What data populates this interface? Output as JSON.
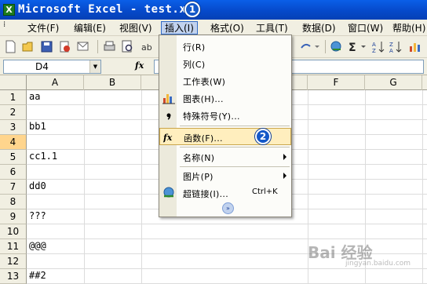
{
  "window": {
    "title": "Microsoft Excel - test.xls",
    "callout_1": "1",
    "title_color": "#0a5fe8"
  },
  "menubar": {
    "items": [
      {
        "label": "文件(F)"
      },
      {
        "label": "编辑(E)"
      },
      {
        "label": "视图(V)"
      },
      {
        "label": "插入(I)",
        "active": true
      },
      {
        "label": "格式(O)"
      },
      {
        "label": "工具(T)"
      },
      {
        "label": "数据(D)"
      },
      {
        "label": "窗口(W)"
      },
      {
        "label": "帮助(H)"
      }
    ]
  },
  "formula_bar": {
    "name_box": "D4",
    "fx": "fx"
  },
  "grid": {
    "columns": [
      "A",
      "B",
      "F",
      "G"
    ],
    "rows": [
      {
        "num": "1",
        "a": "aa"
      },
      {
        "num": "2",
        "a": ""
      },
      {
        "num": "3",
        "a": "bb1"
      },
      {
        "num": "4",
        "a": "",
        "selected": true
      },
      {
        "num": "5",
        "a": "cc1.1"
      },
      {
        "num": "6",
        "a": ""
      },
      {
        "num": "7",
        "a": "dd0"
      },
      {
        "num": "8",
        "a": ""
      },
      {
        "num": "9",
        "a": "???"
      },
      {
        "num": "10",
        "a": ""
      },
      {
        "num": "11",
        "a": "@@@"
      },
      {
        "num": "12",
        "a": ""
      },
      {
        "num": "13",
        "a": "##2"
      }
    ]
  },
  "insert_menu": {
    "items": [
      {
        "label": "行(R)",
        "icon": "none"
      },
      {
        "label": "列(C)",
        "icon": "none"
      },
      {
        "label": "工作表(W)",
        "icon": "none"
      },
      {
        "label": "图表(H)...",
        "icon": "chart-icon"
      },
      {
        "label": "特殊符号(Y)...",
        "icon": "comma-icon"
      },
      {
        "label": "函数(F)...",
        "icon": "fx-icon",
        "highlighted": true
      },
      {
        "label": "名称(N)",
        "icon": "none",
        "submenu": true
      },
      {
        "label": "图片(P)",
        "icon": "none",
        "submenu": true
      },
      {
        "label": "超链接(I)...",
        "icon": "hyperlink-icon",
        "shortcut": "Ctrl+K"
      }
    ],
    "callout_2": "2",
    "expand_glyph": "»"
  },
  "watermark": {
    "text": "Bai 经验",
    "sub": "jingyan.baidu.com"
  }
}
